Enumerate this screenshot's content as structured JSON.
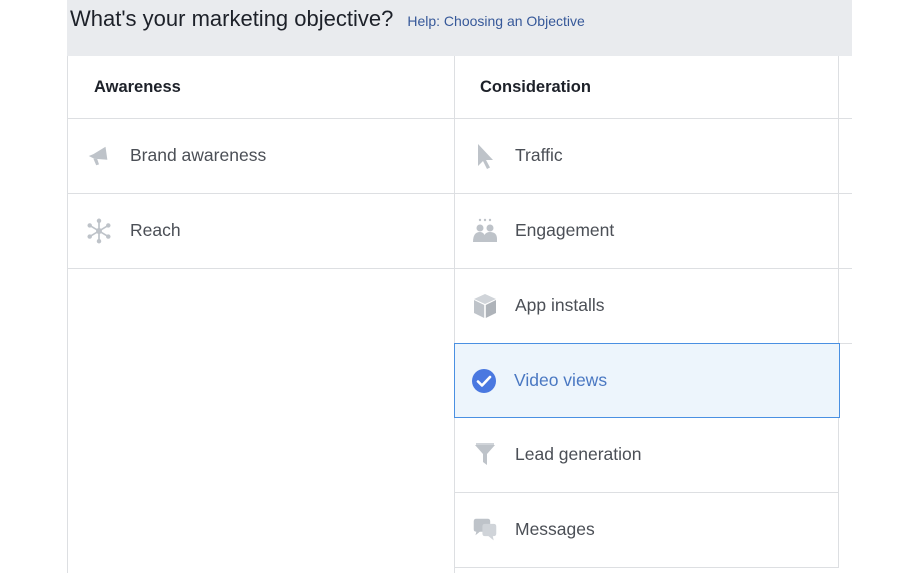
{
  "header": {
    "title": "What's your marketing objective?",
    "help_link": "Help: Choosing an Objective"
  },
  "columns": [
    {
      "heading": "Awareness",
      "items": [
        {
          "label": "Brand awareness",
          "icon": "megaphone-icon"
        },
        {
          "label": "Reach",
          "icon": "reach-icon"
        }
      ]
    },
    {
      "heading": "Consideration",
      "items": [
        {
          "label": "Traffic",
          "icon": "cursor-icon"
        },
        {
          "label": "Engagement",
          "icon": "people-icon"
        },
        {
          "label": "App installs",
          "icon": "box-icon"
        },
        {
          "label": "Video views",
          "icon": "checkmark-icon",
          "selected": true
        },
        {
          "label": "Lead generation",
          "icon": "funnel-icon"
        },
        {
          "label": "Messages",
          "icon": "chat-bubbles-icon"
        }
      ]
    }
  ],
  "colors": {
    "icon_gray": "#bec3c9",
    "selected_border": "#4a90e2",
    "selected_bg": "#edf5fc",
    "link": "#365899"
  }
}
